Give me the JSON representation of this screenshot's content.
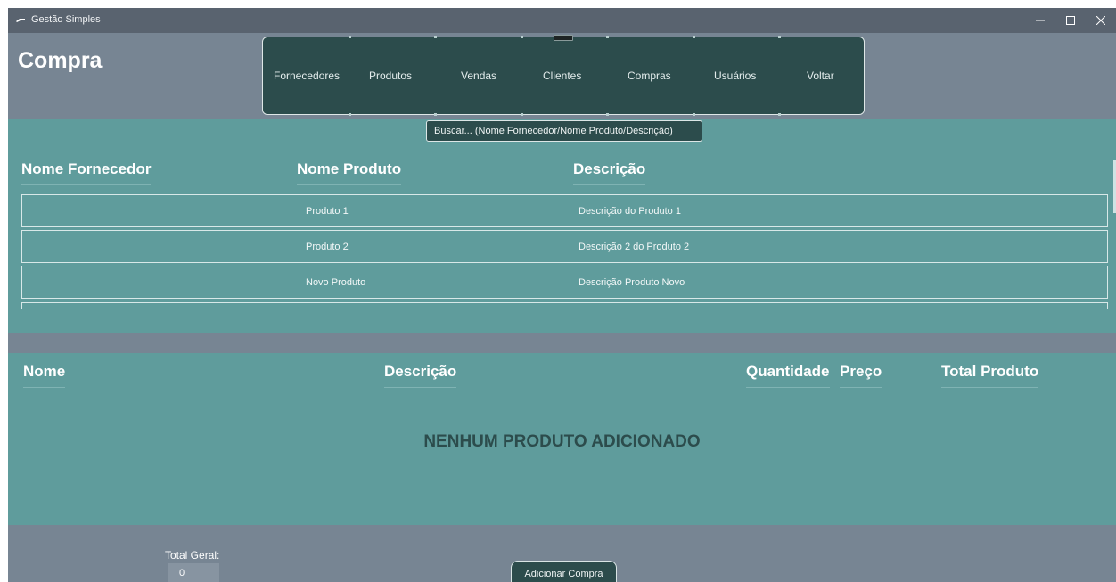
{
  "window": {
    "title": "Gestão Simples",
    "app_icon": "gear-icon",
    "controls": {
      "minimize": "minimize-icon",
      "maximize": "maximize-icon",
      "close": "close-icon"
    }
  },
  "page": {
    "title": "Compra"
  },
  "nav": {
    "items": [
      "Fornecedores",
      "Produtos",
      "Vendas",
      "Clientes",
      "Compras",
      "Usuários",
      "Voltar"
    ]
  },
  "search": {
    "text": "Buscar... (Nome Fornecedor/Nome Produto/Descrição)"
  },
  "results": {
    "headers": {
      "fornecedor": "Nome Fornecedor",
      "produto": "Nome Produto",
      "descricao": "Descrição"
    },
    "rows": [
      {
        "fornecedor": "",
        "produto": "Produto 1",
        "descricao": "Descrição do Produto 1"
      },
      {
        "fornecedor": "",
        "produto": "Produto 2",
        "descricao": "Descrição 2 do Produto 2"
      },
      {
        "fornecedor": "",
        "produto": "Novo Produto",
        "descricao": "Descrição Produto Novo"
      }
    ]
  },
  "cart": {
    "headers": {
      "nome": "Nome",
      "descricao": "Descrição",
      "quantidade": "Quantidade",
      "preco": "Preço",
      "total": "Total Produto"
    },
    "empty_message": "NENHUM PRODUTO ADICIONADO"
  },
  "footer": {
    "total_label": "Total Geral:",
    "total_value": "0",
    "add_button": "Adicionar Compra"
  },
  "colors": {
    "background": "#778593",
    "titlebar": "#59636f",
    "panel": "#5f9c9c",
    "dark": "#2c4c4c"
  }
}
